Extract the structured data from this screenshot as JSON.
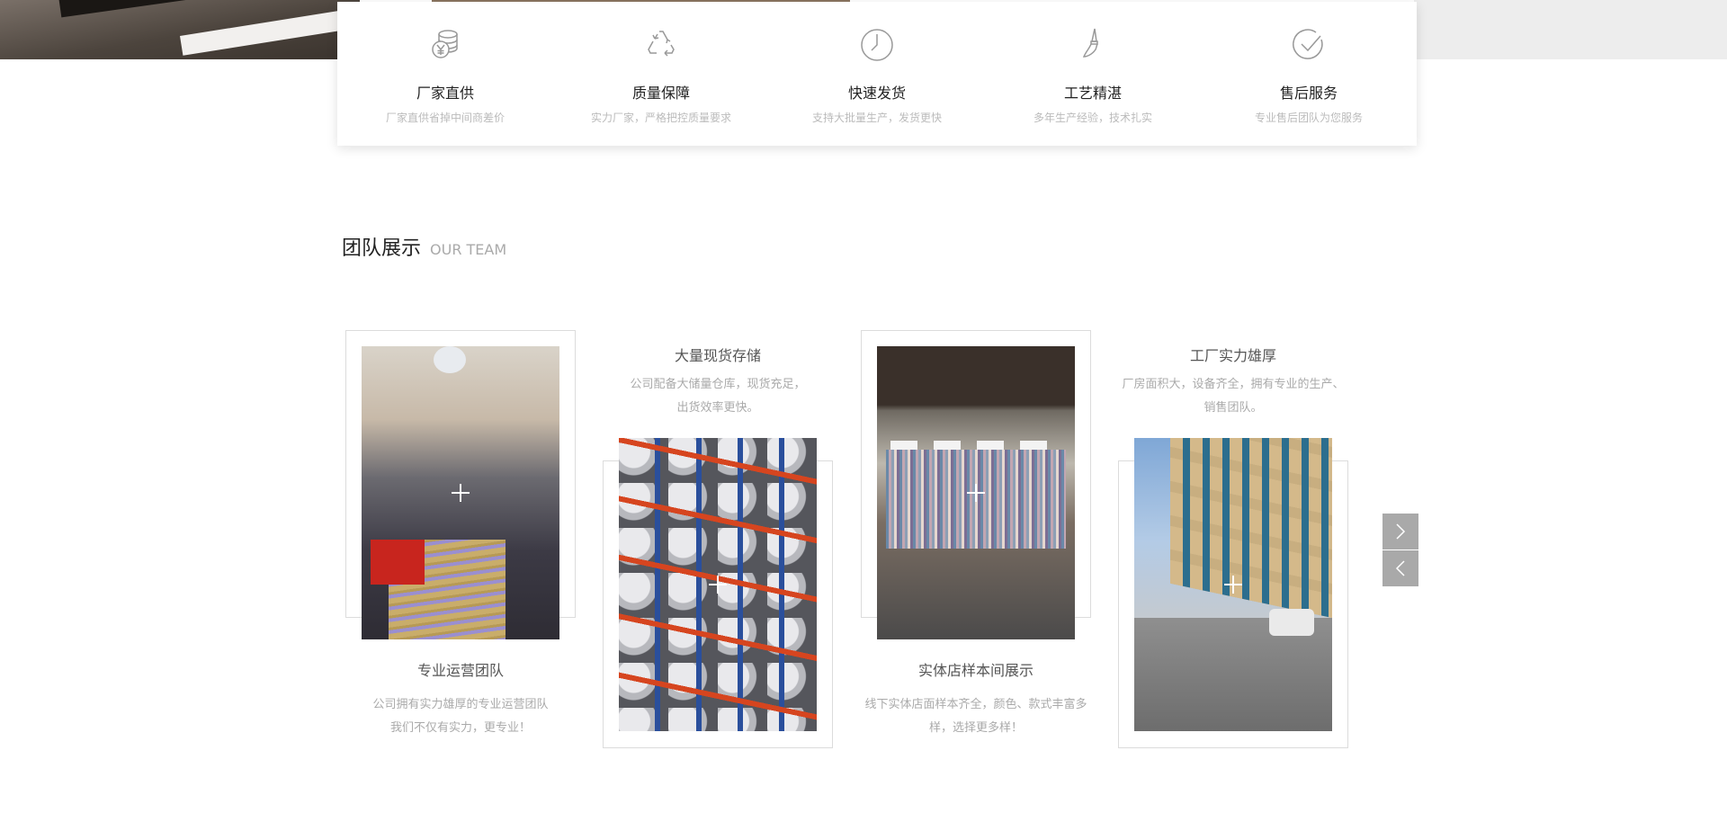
{
  "features": [
    {
      "icon": "coin-stack-icon",
      "title": "厂家直供",
      "desc": "厂家直供省掉中间商差价"
    },
    {
      "icon": "recycle-icon",
      "title": "质量保障",
      "desc": "实力厂家，严格把控质量要求"
    },
    {
      "icon": "clock-icon",
      "title": "快速发货",
      "desc": "支持大批量生产，发货更快"
    },
    {
      "icon": "brush-icon",
      "title": "工艺精湛",
      "desc": "多年生产经验，技术扎实"
    },
    {
      "icon": "check-circle-icon",
      "title": "售后服务",
      "desc": "专业售后团队为您服务"
    }
  ],
  "section": {
    "title": "团队展示",
    "subtitle": "OUR TEAM"
  },
  "cards": [
    {
      "title": "专业运营团队",
      "desc_line1": "公司拥有实力雄厚的专业运营团队",
      "desc_line2": "我们不仅有实力，更专业！"
    },
    {
      "title": "大量现货存储",
      "desc_line1": "公司配备大储量仓库，现货充足，",
      "desc_line2": "出货效率更快。"
    },
    {
      "title": "实体店样本间展示",
      "desc_line1": "线下实体店面样本齐全，颜色、款式丰富多",
      "desc_line2": "样，选择更多样！"
    },
    {
      "title": "工厂实力雄厚",
      "desc_line1": "厂房面积大，设备齐全，拥有专业的生产、",
      "desc_line2": "销售团队。"
    }
  ],
  "carousel": {
    "next_icon": "chevron-right-icon",
    "prev_icon": "chevron-left-icon"
  },
  "colors": {
    "nav_button": "#a9a9a9",
    "title_text": "#222222",
    "muted_text": "#aaaaaa"
  }
}
